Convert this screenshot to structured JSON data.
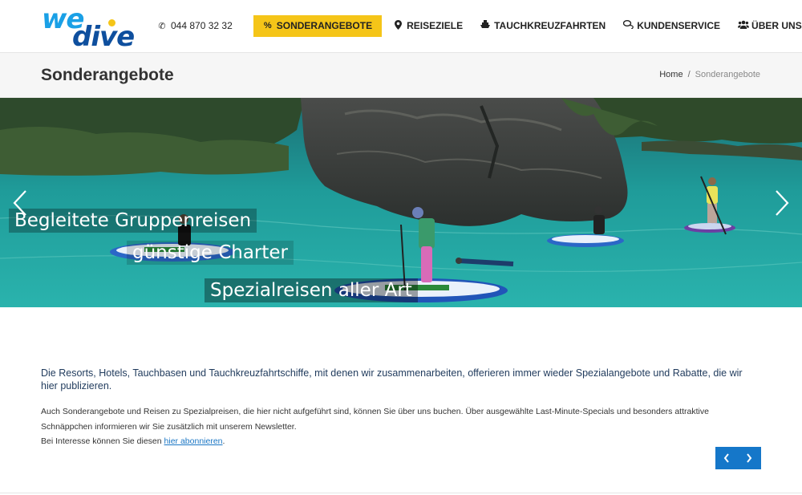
{
  "brand": {
    "logo_we": "we",
    "logo_dive": "dive",
    "accent": "#f5c518",
    "blue": "#1577c9"
  },
  "nav": {
    "phone": "044 870 32 32",
    "items": [
      {
        "label": "Sonderangebote",
        "icon": "percent-icon"
      },
      {
        "label": "Reiseziele",
        "icon": "map-marker-icon"
      },
      {
        "label": "Tauchkreuzfahrten",
        "icon": "ship-icon"
      },
      {
        "label": "Kundenservice",
        "icon": "chat-icon"
      },
      {
        "label": "Über uns",
        "icon": "users-icon"
      }
    ],
    "search_icon": "search-icon"
  },
  "titlebar": {
    "title": "Sonderangebote",
    "breadcrumb": {
      "home": "Home",
      "separator": "/",
      "current": "Sonderangebote"
    }
  },
  "hero": {
    "captions": [
      "Begleitete Gruppenreisen",
      "günstige Charter",
      "Spezialreisen aller Art"
    ]
  },
  "content": {
    "intro": "Die Resorts, Hotels, Tauchbasen und Tauchkreuzfahrtschiffe, mit denen wir zusammenarbeiten, offerieren immer wieder Spezialangebote und Rabatte, die wir hier publizieren.",
    "paragraph1": "Auch Sonderangebote und Reisen zu Spezialpreisen, die hier nicht aufgeführt sind, können Sie über uns buchen. Über ausgewählte Last-Minute-Specials und besonders attraktive Schnäppchen informieren wir Sie zusätzlich mit unserem Newsletter.",
    "paragraph2_prefix": "Bei Interesse können Sie diesen ",
    "paragraph2_link": "hier abonnieren",
    "paragraph2_suffix": "."
  }
}
